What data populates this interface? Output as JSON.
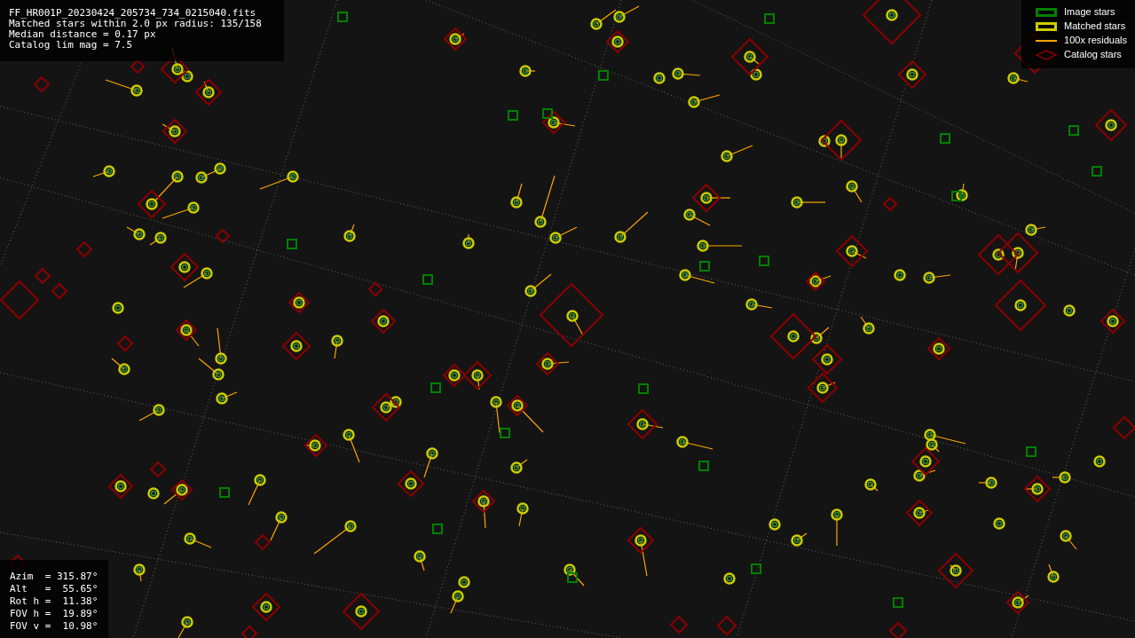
{
  "info_lines": [
    "FF_HR001P_20230424_205734_734_0215040.fits",
    "Matched stars within 2.0 px radius: 135/158",
    "Median distance = 0.17 px",
    "Catalog lim mag = 7.5"
  ],
  "legend": [
    {
      "kind": "image",
      "label": "Image stars",
      "color": "#008000"
    },
    {
      "kind": "matched",
      "label": "Matched stars",
      "color": "#cccc00"
    },
    {
      "kind": "residual",
      "label": "100x residuals",
      "color": "#ffa500"
    },
    {
      "kind": "catalog",
      "label": "Catalog stars",
      "color": "#8b0000"
    }
  ],
  "pointing": [
    "Azim  = 315.87°",
    "Alt   =  55.65°",
    "Rot h =  11.38°",
    "FOV h =  19.89°",
    "FOV v =  10.98°"
  ]
}
